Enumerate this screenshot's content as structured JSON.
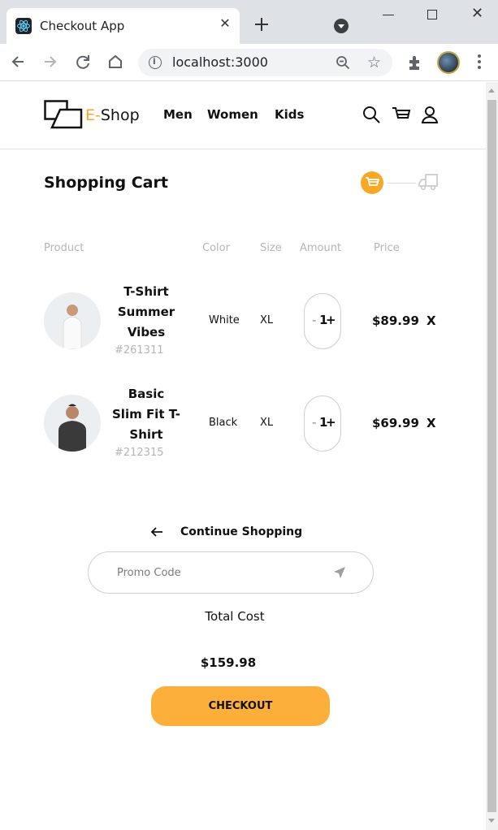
{
  "browser": {
    "tab_title": "Checkout App",
    "url": "localhost:3000"
  },
  "header": {
    "logo_prefix": "E-",
    "logo_suffix": "Shop",
    "nav": [
      {
        "label": "Men"
      },
      {
        "label": "Women"
      },
      {
        "label": "Kids"
      }
    ]
  },
  "cart": {
    "title": "Shopping Cart",
    "columns": {
      "product": "Product",
      "color": "Color",
      "size": "Size",
      "amount": "Amount",
      "price": "Price"
    },
    "items": [
      {
        "name_lines": [
          "T-Shirt",
          "Summer",
          "Vibes"
        ],
        "sku": "#261311",
        "color": "White",
        "size": "XL",
        "minus": "-",
        "quantity": "1",
        "plus": "+",
        "price": "$89.99",
        "remove": "X"
      },
      {
        "name_lines": [
          "Basic",
          "Slim Fit T-",
          "Shirt"
        ],
        "sku": "#212315",
        "color": "Black",
        "size": "XL",
        "minus": "-",
        "quantity": "1",
        "plus": "+",
        "price": "$69.99",
        "remove": "X"
      }
    ],
    "continue_label": "Continue Shopping",
    "promo_placeholder": "Promo Code",
    "total_label": "Total Cost",
    "total_value": "$159.98",
    "checkout_label": "CHECKOUT"
  },
  "colors": {
    "accent": "#f9a825",
    "checkout_button": "#fcaf3a"
  }
}
